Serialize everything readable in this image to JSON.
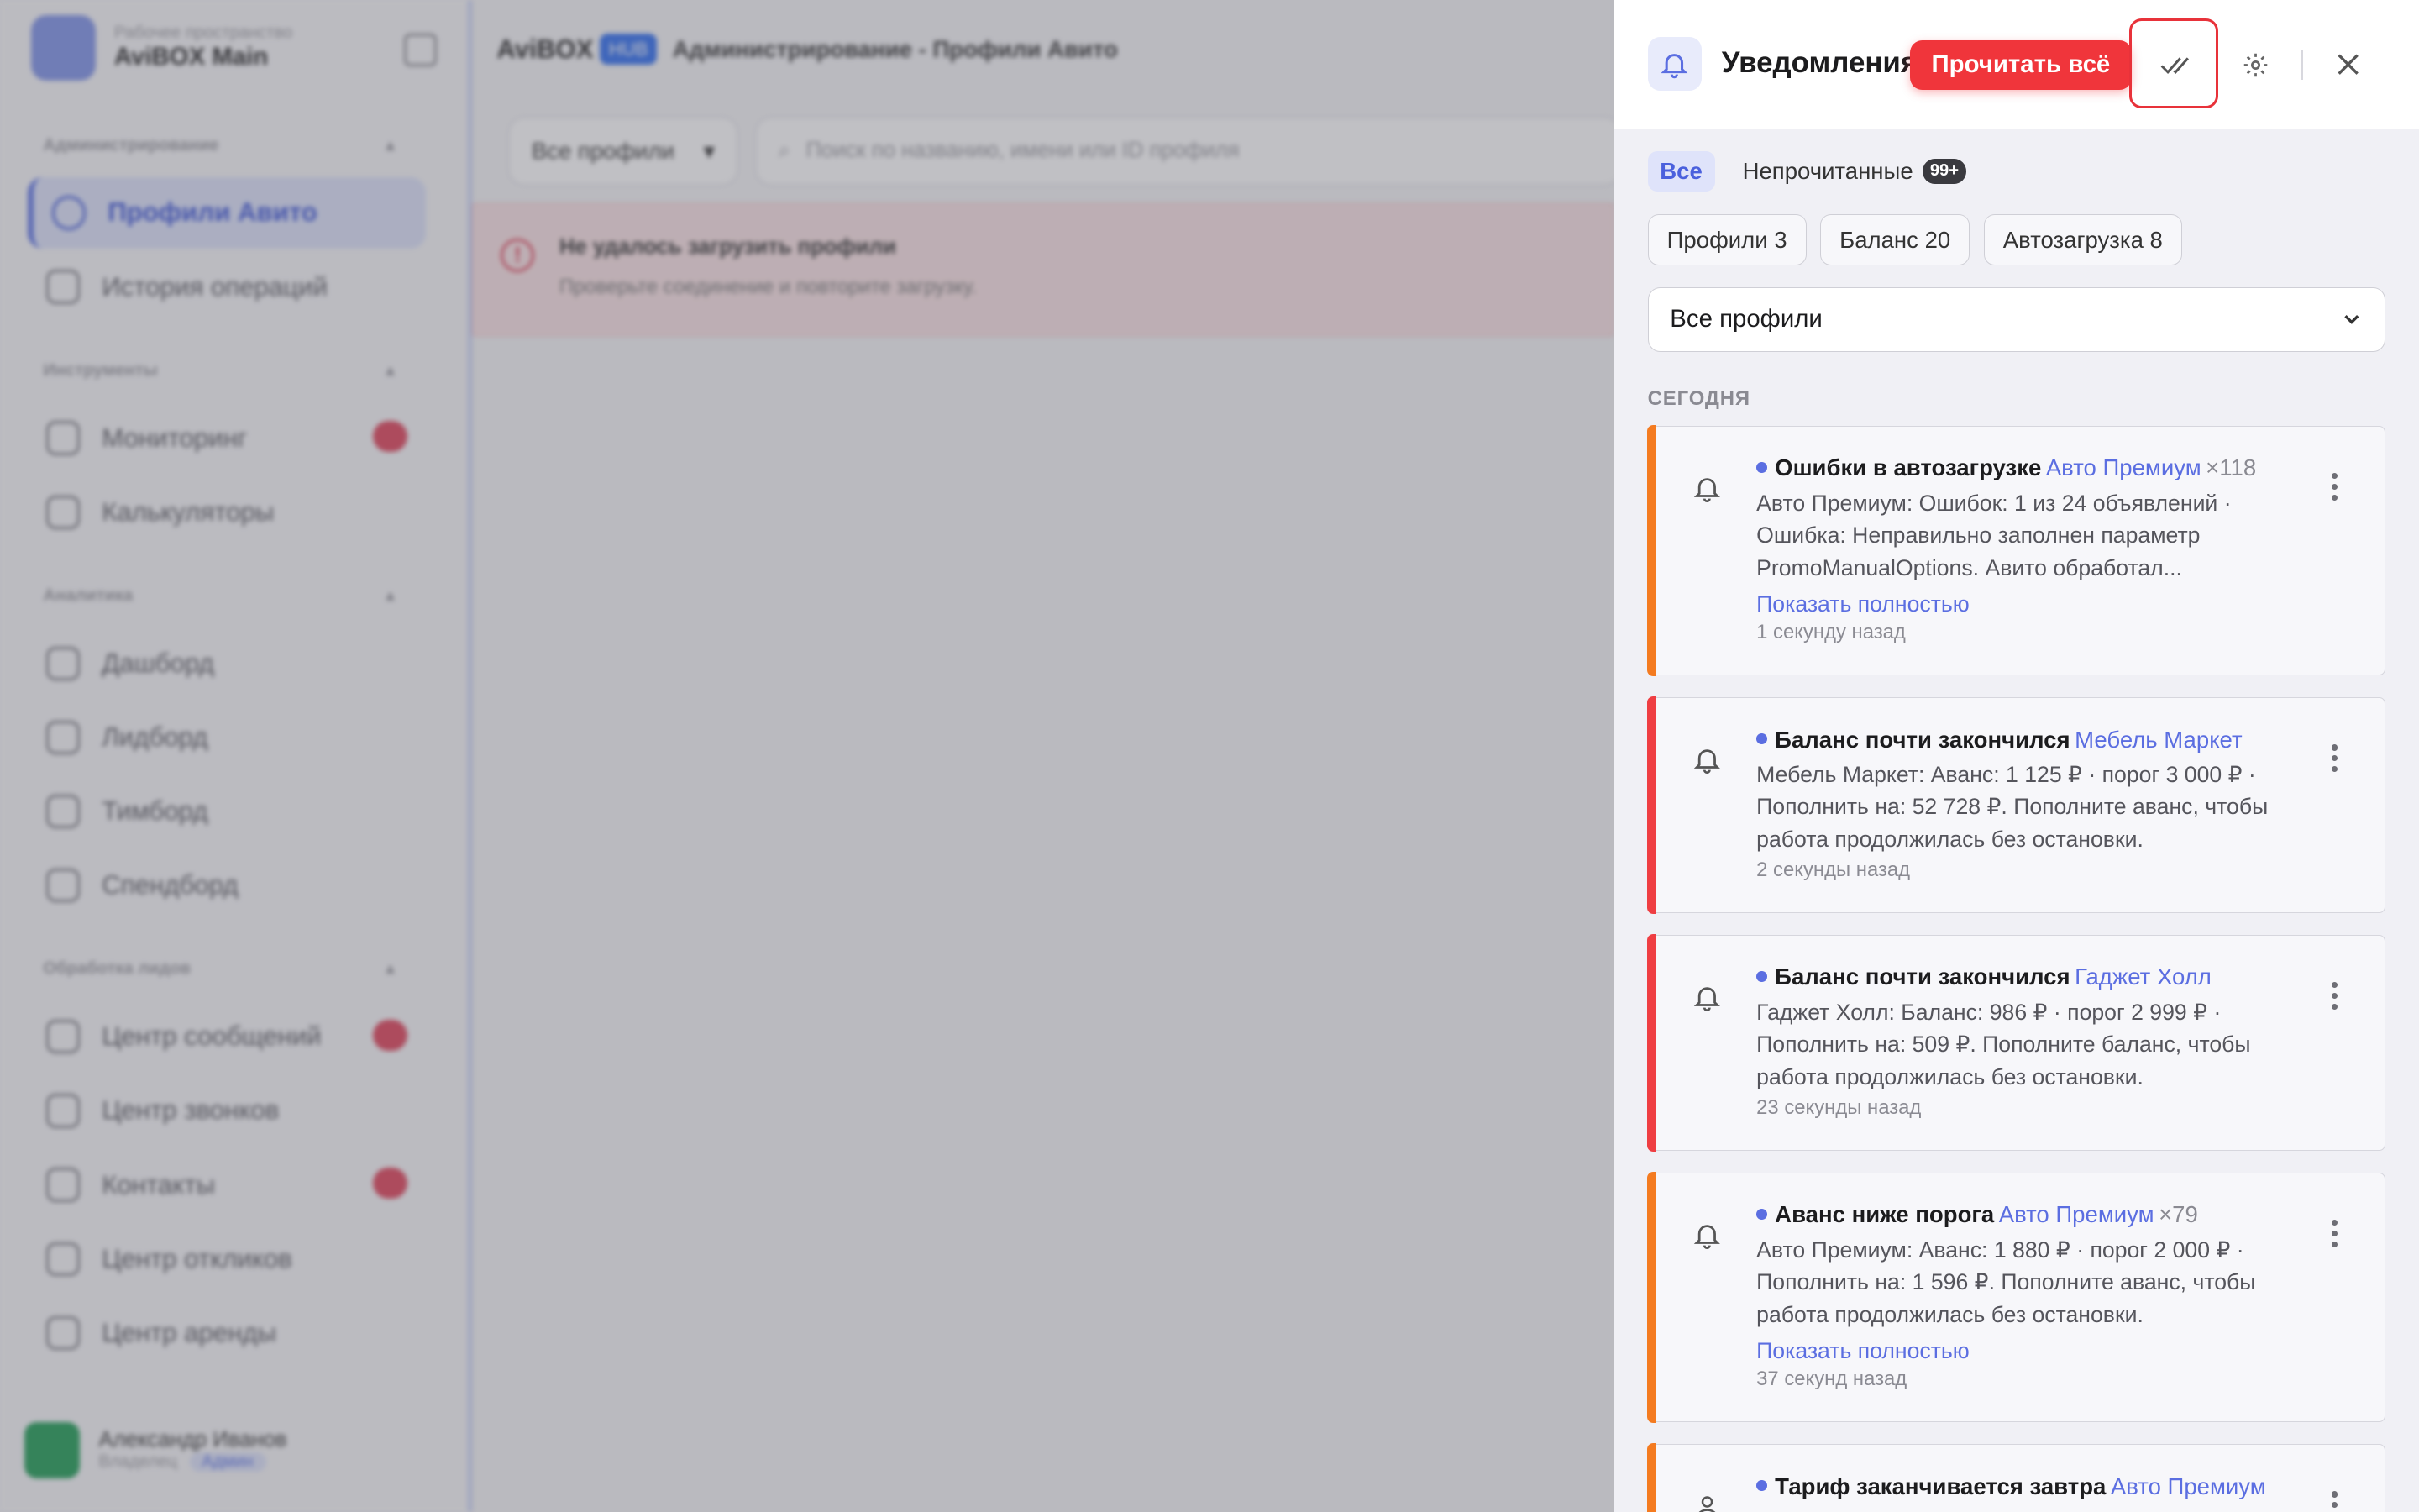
{
  "workspace": {
    "subtitle": "Рабочее пространство",
    "name": "AviBOX Main"
  },
  "sidebar": {
    "sections": [
      {
        "title": "Администрирование",
        "items": [
          {
            "label": "Профили Авито",
            "active": true
          },
          {
            "label": "История операций"
          }
        ]
      },
      {
        "title": "Инструменты",
        "items": [
          {
            "label": "Мониторинг",
            "badge": ""
          },
          {
            "label": "Калькуляторы"
          }
        ]
      },
      {
        "title": "Аналитика",
        "items": [
          {
            "label": "Дашборд"
          },
          {
            "label": "Лидборд"
          },
          {
            "label": "Тимборд"
          },
          {
            "label": "Спендборд"
          }
        ]
      },
      {
        "title": "Обработка лидов",
        "items": [
          {
            "label": "Центр сообщений",
            "badge": ""
          },
          {
            "label": "Центр звонков"
          },
          {
            "label": "Контакты",
            "badge": ""
          },
          {
            "label": "Центр откликов"
          },
          {
            "label": "Центр аренды"
          }
        ]
      }
    ],
    "user": {
      "name": "Александр Иванов",
      "role": "Владелец",
      "tag": "Админ"
    }
  },
  "header": {
    "brand": "AviBOX",
    "brand_hub": "HUB",
    "breadcrumb": "Администрирование - Профили Авито"
  },
  "filters": {
    "profile_select": "Все профили",
    "search_placeholder": "Поиск по названию, имени или ID профиля"
  },
  "error": {
    "title": "Не удалось загрузить профили",
    "subtitle": "Проверьте соединение и повторите загрузку."
  },
  "notifications": {
    "title": "Уведомления",
    "read_all": "Прочитать всё",
    "tabs": {
      "all": "Все",
      "unread": "Непрочитанные",
      "unread_count": "99+"
    },
    "chips": [
      "Профили 3",
      "Баланс 20",
      "Автозагрузка 8"
    ],
    "profile_filter": "Все профили",
    "day_label": "СЕГОДНЯ",
    "items": [
      {
        "title": "Ошибки в автозагрузке",
        "profile": "Авто Премиум",
        "multiplier": "×118",
        "text": "Авто Премиум: Ошибок: 1 из 24 объявлений · Ошибка: Неправильно заполнен параметр PromoManualOptions. Авито обработал...",
        "more": "Показать полностью",
        "time": "1 секунду назад",
        "color": "#f47b20",
        "icon": "bell-icon"
      },
      {
        "title": "Баланс почти закончился",
        "profile": "Мебель Маркет",
        "multiplier": "",
        "text": "Мебель Маркет: Аванс: 1 125 ₽ · порог 3 000 ₽ · Пополнить на: 52 728 ₽. Пополните аванс, чтобы работа продолжилась без остановки.",
        "more": "",
        "time": "2 секунды назад",
        "color": "#ef3e42",
        "icon": "bell-icon"
      },
      {
        "title": "Баланс почти закончился",
        "profile": "Гаджет Холл",
        "multiplier": "",
        "text": "Гаджет Холл: Баланс: 986 ₽ · порог 2 999 ₽ · Пополнить на: 509 ₽. Пополните баланс, чтобы работа продолжилась без остановки.",
        "more": "",
        "time": "23 секунды назад",
        "color": "#ef3e42",
        "icon": "bell-icon"
      },
      {
        "title": "Аванс ниже порога",
        "profile": "Авто Премиум",
        "multiplier": "×79",
        "text": "Авто Премиум: Аванс: 1 880 ₽ · порог 2 000 ₽ · Пополнить на: 1 596 ₽. Пополните аванс, чтобы работа продолжилась без остановки.",
        "more": "Показать полностью",
        "time": "37 секунд назад",
        "color": "#f47b20",
        "icon": "bell-icon"
      },
      {
        "title": "Тариф заканчивается завтра",
        "profile": "Авто Премиум",
        "multiplier": "",
        "text": "",
        "more": "",
        "time": "",
        "color": "#f47b20",
        "icon": "user-icon"
      }
    ]
  }
}
